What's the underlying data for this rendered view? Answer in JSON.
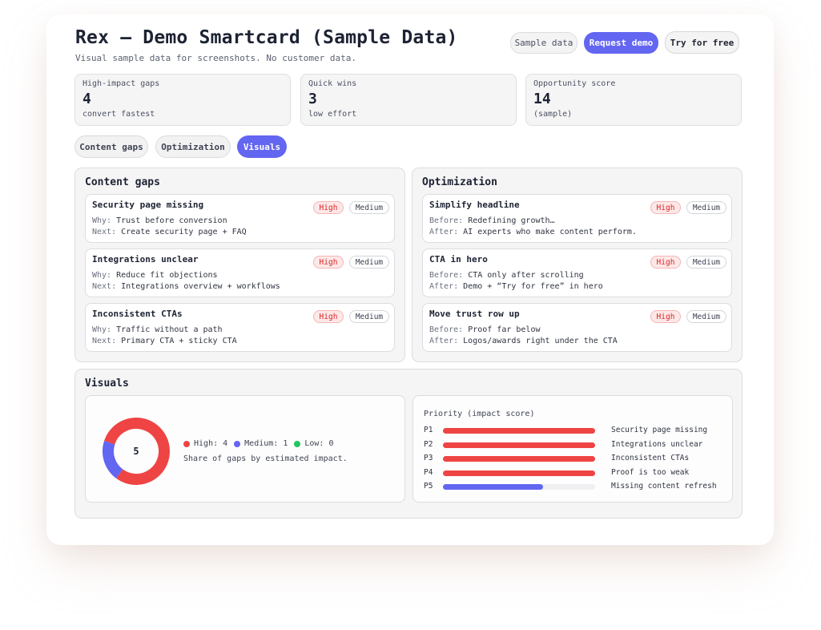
{
  "header": {
    "title": "Rex – Demo Smartcard (Sample Data)",
    "subtitle": "Visual sample data for screenshots. No customer data.",
    "sample_label": "Sample data",
    "request_label": "Request demo",
    "try_label": "Try for free"
  },
  "stats": [
    {
      "label": "High-impact gaps",
      "value": "4",
      "sub": "convert fastest"
    },
    {
      "label": "Quick wins",
      "value": "3",
      "sub": "low effort"
    },
    {
      "label": "Opportunity score",
      "value": "14",
      "sub": "(sample)"
    }
  ],
  "tabs": [
    {
      "label": "Content gaps",
      "active": false
    },
    {
      "label": "Optimization",
      "active": false
    },
    {
      "label": "Visuals",
      "active": true
    }
  ],
  "content_gaps": {
    "title": "Content gaps",
    "items": [
      {
        "title": "Security page missing",
        "why": "Trust before conversion",
        "next": "Create security page + FAQ",
        "impact": "High",
        "effort": "Medium"
      },
      {
        "title": "Integrations unclear",
        "why": "Reduce fit objections",
        "next": "Integrations overview + workflows",
        "impact": "High",
        "effort": "Medium"
      },
      {
        "title": "Inconsistent CTAs",
        "why": "Traffic without a path",
        "next": "Primary CTA + sticky CTA",
        "impact": "High",
        "effort": "Medium"
      }
    ],
    "why_prefix": "Why:",
    "next_prefix": "Next:"
  },
  "optimization": {
    "title": "Optimization",
    "items": [
      {
        "title": "Simplify headline",
        "before": "Redefining growth…",
        "after": "AI experts who make content perform.",
        "impact": "High",
        "effort": "Medium"
      },
      {
        "title": "CTA in hero",
        "before": "CTA only after scrolling",
        "after": "Demo + “Try for free” in hero",
        "impact": "High",
        "effort": "Medium"
      },
      {
        "title": "Move trust row up",
        "before": "Proof far below",
        "after": "Logos/awards right under the CTA",
        "impact": "High",
        "effort": "Medium"
      }
    ],
    "before_prefix": "Before:",
    "after_prefix": "After:"
  },
  "visuals": {
    "title": "Visuals",
    "donut_total": "5",
    "legend": [
      {
        "label": "High: 4",
        "color": "#ef4444"
      },
      {
        "label": "Medium: 1",
        "color": "#6366f1"
      },
      {
        "label": "Low: 0",
        "color": "#22c55e"
      }
    ],
    "caption": "Share of gaps by estimated impact.",
    "priority_title": "Priority (impact score)",
    "priorities": [
      {
        "rank": "P1",
        "name": "Security page missing",
        "fraction": 1.0,
        "color": "#ef4444"
      },
      {
        "rank": "P2",
        "name": "Integrations unclear",
        "fraction": 1.0,
        "color": "#ef4444"
      },
      {
        "rank": "P3",
        "name": "Inconsistent CTAs",
        "fraction": 1.0,
        "color": "#ef4444"
      },
      {
        "rank": "P4",
        "name": "Proof is too weak",
        "fraction": 1.0,
        "color": "#ef4444"
      },
      {
        "rank": "P5",
        "name": "Missing content refresh",
        "fraction": 0.66,
        "color": "#6366f1"
      }
    ]
  },
  "chart_data": {
    "type": "pie",
    "categories": [
      "High",
      "Medium",
      "Low"
    ],
    "values": [
      4,
      1,
      0
    ],
    "colors": [
      "#ef4444",
      "#6366f1",
      "#22c55e"
    ],
    "title": ""
  }
}
